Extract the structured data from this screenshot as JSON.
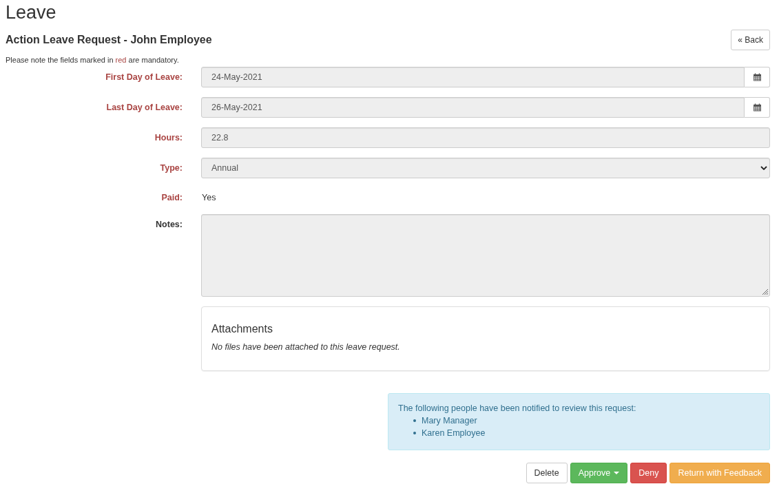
{
  "page_title": "Leave",
  "form": {
    "title": "Action Leave Request - John Employee",
    "back_button": "« Back",
    "note": [
      {
        "kind": "plain",
        "text": "Please note the fields marked in "
      },
      {
        "kind": "required",
        "text": "red"
      },
      {
        "kind": "plain",
        "text": " are mandatory."
      }
    ],
    "fields": [
      {
        "kind": "date",
        "label": "First Day of Leave:",
        "required": true,
        "value": "24-May-2021",
        "disabled": true
      },
      {
        "kind": "date",
        "label": "Last Day of Leave:",
        "required": true,
        "value": "26-May-2021",
        "disabled": true
      },
      {
        "kind": "text",
        "label": "Hours:",
        "required": true,
        "value": "22.8",
        "disabled": true
      },
      {
        "kind": "select",
        "label": "Type:",
        "required": true,
        "value": "Annual",
        "disabled": true
      },
      {
        "kind": "static",
        "label": "Paid:",
        "required": true,
        "value": "Yes"
      },
      {
        "kind": "textarea",
        "label": "Notes:",
        "required": false,
        "disabled": true
      }
    ]
  },
  "attachments": {
    "title": "Attachments",
    "empty_message": "No files have been attached to this leave request."
  },
  "notification": {
    "message": "The following people have been notified to review this request:",
    "people": [
      "Mary Manager",
      "Karen Employee"
    ]
  },
  "actions": [
    {
      "kind": "default",
      "label": "Delete",
      "dropdown": false
    },
    {
      "kind": "success",
      "label": "Approve",
      "dropdown": true
    },
    {
      "kind": "danger",
      "label": "Deny",
      "dropdown": false
    },
    {
      "kind": "warning",
      "label": "Return with Feedback",
      "dropdown": false
    }
  ]
}
